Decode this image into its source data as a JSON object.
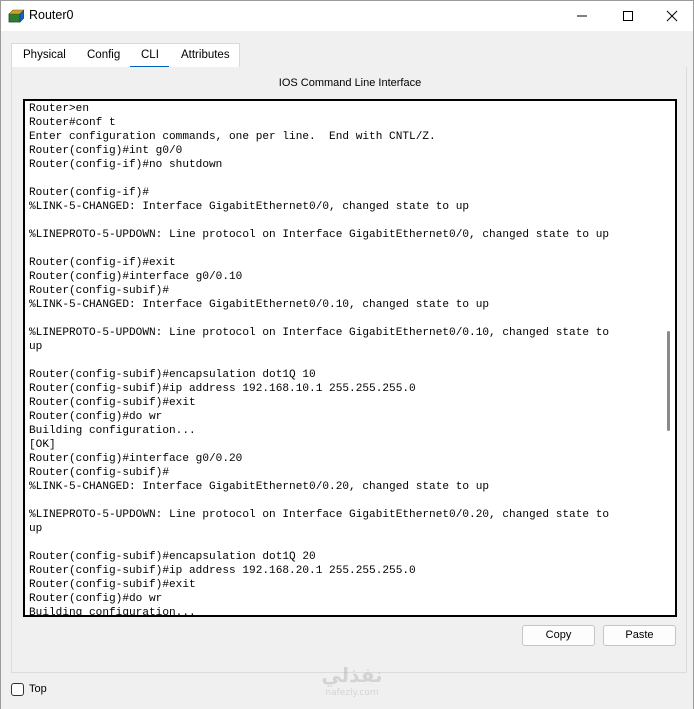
{
  "window": {
    "title": "Router0"
  },
  "tabs": [
    {
      "label": "Physical"
    },
    {
      "label": "Config"
    },
    {
      "label": "CLI",
      "active": true
    },
    {
      "label": "Attributes"
    }
  ],
  "panel": {
    "header": "IOS Command Line Interface"
  },
  "terminal": {
    "lines": [
      "Router>en",
      "Router#conf t",
      "Enter configuration commands, one per line.  End with CNTL/Z.",
      "Router(config)#int g0/0",
      "Router(config-if)#no shutdown",
      "",
      "Router(config-if)#",
      "%LINK-5-CHANGED: Interface GigabitEthernet0/0, changed state to up",
      "",
      "%LINEPROTO-5-UPDOWN: Line protocol on Interface GigabitEthernet0/0, changed state to up",
      "",
      "Router(config-if)#exit",
      "Router(config)#interface g0/0.10",
      "Router(config-subif)#",
      "%LINK-5-CHANGED: Interface GigabitEthernet0/0.10, changed state to up",
      "",
      "%LINEPROTO-5-UPDOWN: Line protocol on Interface GigabitEthernet0/0.10, changed state to",
      "up",
      "",
      "Router(config-subif)#encapsulation dot1Q 10",
      "Router(config-subif)#ip address 192.168.10.1 255.255.255.0",
      "Router(config-subif)#exit",
      "Router(config)#do wr",
      "Building configuration...",
      "[OK]",
      "Router(config)#interface g0/0.20",
      "Router(config-subif)#",
      "%LINK-5-CHANGED: Interface GigabitEthernet0/0.20, changed state to up",
      "",
      "%LINEPROTO-5-UPDOWN: Line protocol on Interface GigabitEthernet0/0.20, changed state to",
      "up",
      "",
      "Router(config-subif)#encapsulation dot1Q 20",
      "Router(config-subif)#ip address 192.168.20.1 255.255.255.0",
      "Router(config-subif)#exit",
      "Router(config)#do wr",
      "Building configuration..."
    ]
  },
  "buttons": {
    "copy": "Copy",
    "paste": "Paste"
  },
  "footer": {
    "top_label": "Top",
    "top_checked": false
  },
  "watermark": {
    "arabic": "نفذلي",
    "latin": "nafezly.com"
  },
  "icons": {
    "app": "router-app-icon",
    "minimize": "minimize-icon",
    "maximize": "maximize-icon",
    "close": "close-icon"
  },
  "colors": {
    "accent": "#005fb8",
    "terminal_bg": "#ffffff",
    "window_bg": "#f0f0f0"
  }
}
